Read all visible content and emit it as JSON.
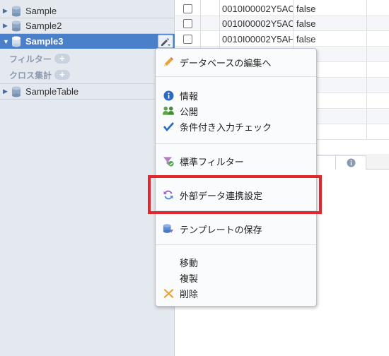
{
  "sidebar": {
    "items": [
      {
        "label": "Sample"
      },
      {
        "label": "Sample2"
      },
      {
        "label": "Sample3"
      },
      {
        "label": "SampleTable"
      }
    ],
    "filter_label": "フィルター",
    "cross_label": "クロス集計",
    "plus": "+"
  },
  "grid": {
    "rows": [
      {
        "id": "0010I00002Y5AC",
        "value": "false"
      },
      {
        "id": "0010I00002Y5AC",
        "value": "false"
      },
      {
        "id": "0010I00002Y5AH",
        "value": "false"
      }
    ]
  },
  "menu": {
    "items": [
      {
        "label": "データベースの編集へ",
        "icon": "pencil-icon"
      },
      {
        "label": "情報",
        "icon": "info-icon"
      },
      {
        "label": "公開",
        "icon": "users-icon"
      },
      {
        "label": "条件付き入力チェック",
        "icon": "checkmark-icon"
      },
      {
        "label": "標準フィルター",
        "icon": "filter-icon"
      },
      {
        "label": "外部データ連携設定",
        "icon": "sync-icon"
      },
      {
        "label": "テンプレートの保存",
        "icon": "template-save-icon"
      },
      {
        "label": "移動"
      },
      {
        "label": "複製"
      },
      {
        "label": "削除",
        "icon": "delete-icon"
      }
    ]
  },
  "colors": {
    "selected_row": "#4a7fc9",
    "highlight_box": "#e3262b",
    "sidebar_bg": "#e4e9f0"
  }
}
